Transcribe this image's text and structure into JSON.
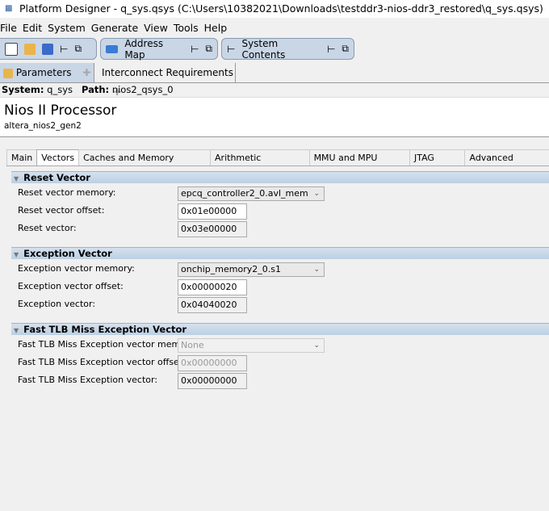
{
  "window": {
    "title": "Platform Designer - q_sys.qsys (C:\\Users\\10382021\\Downloads\\testddr3-nios-ddr3_restored\\q_sys.qsys)"
  },
  "menu": [
    "File",
    "Edit",
    "System",
    "Generate",
    "View",
    "Tools",
    "Help"
  ],
  "toolbar": {
    "address_map": "Address Map",
    "system_contents": "System Contents"
  },
  "panel_tabs": [
    {
      "label": "Parameters"
    },
    {
      "label": "Interconnect Requirements"
    }
  ],
  "path": {
    "system_label": "System:",
    "system": "q_sys",
    "path_label": "Path:",
    "path": "nios2_qsys_0"
  },
  "component": {
    "title": "Nios II Processor",
    "subtitle": "altera_nios2_gen2"
  },
  "param_tabs": [
    "Main",
    "Vectors",
    "Caches and Memory Interfaces",
    "Arithmetic Instructions",
    "MMU and MPU Settings",
    "JTAG Debug",
    "Advanced Features"
  ],
  "sections": [
    {
      "title": "Reset Vector",
      "memory_label": "Reset vector memory:",
      "memory": "epcq_controller2_0.avl_mem",
      "offset_label": "Reset vector offset:",
      "offset": "0x01e00000",
      "vector_label": "Reset vector:",
      "vector": "0x03e00000"
    },
    {
      "title": "Exception Vector",
      "memory_label": "Exception vector memory:",
      "memory": "onchip_memory2_0.s1",
      "offset_label": "Exception vector offset:",
      "offset": "0x00000020",
      "vector_label": "Exception vector:",
      "vector": "0x04040020"
    },
    {
      "title": "Fast TLB Miss Exception Vector",
      "memory_label": "Fast TLB Miss Exception vector memory:",
      "memory": "None",
      "offset_label": "Fast TLB Miss Exception vector offset:",
      "offset": "0x00000000",
      "vector_label": "Fast TLB Miss Exception vector:",
      "vector": "0x00000000"
    }
  ]
}
